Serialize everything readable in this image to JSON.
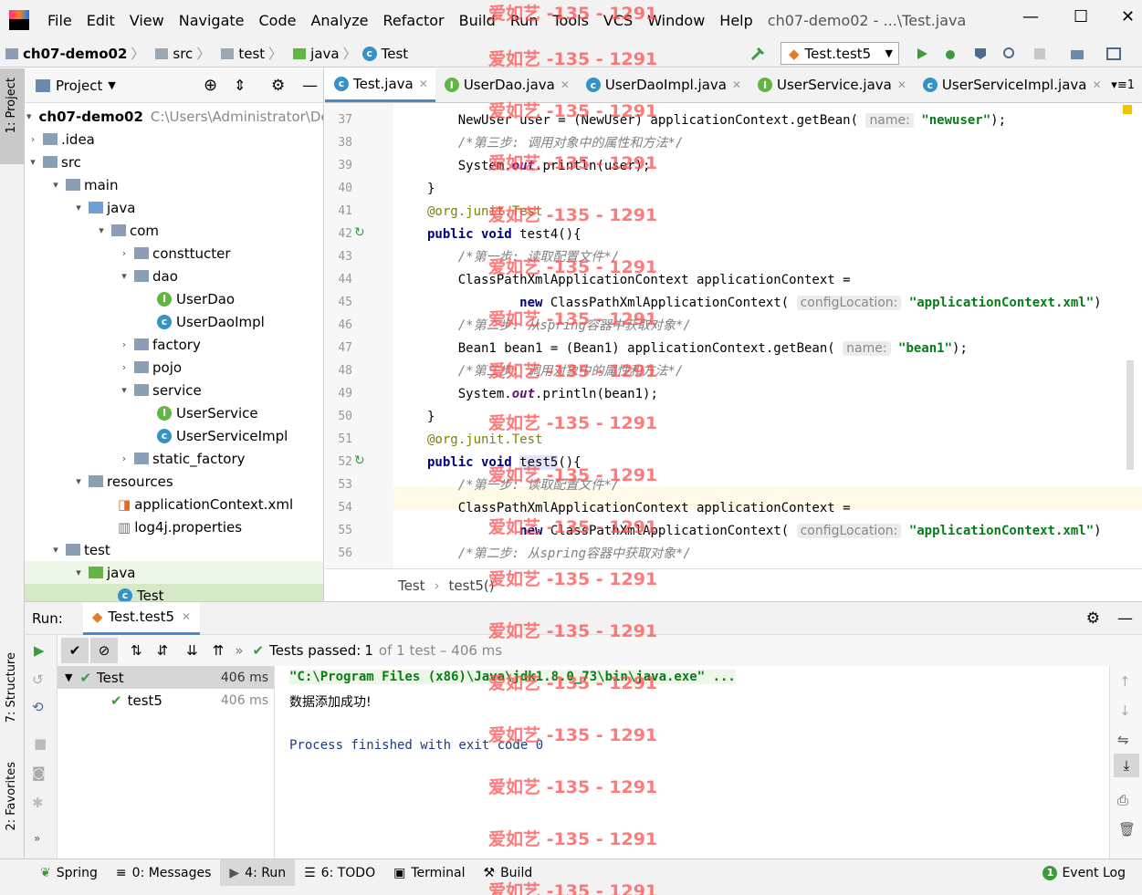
{
  "menubar": {
    "items": [
      "File",
      "Edit",
      "View",
      "Navigate",
      "Code",
      "Analyze",
      "Refactor",
      "Build",
      "Run",
      "Tools",
      "VCS",
      "Window",
      "Help"
    ],
    "title": "ch07-demo02 - ...\\Test.java"
  },
  "navbar": {
    "crumbs": [
      "ch07-demo02",
      "src",
      "test",
      "java",
      "Test"
    ],
    "run_config": "Test.test5"
  },
  "project": {
    "header": "Project",
    "tree": [
      {
        "label": "ch07-demo02",
        "dim": "C:\\Users\\Administrator\\De"
      },
      {
        "label": ".idea"
      },
      {
        "label": "src"
      },
      {
        "label": "main"
      },
      {
        "label": "java"
      },
      {
        "label": "com"
      },
      {
        "label": "consttucter"
      },
      {
        "label": "dao"
      },
      {
        "label": "UserDao"
      },
      {
        "label": "UserDaoImpl"
      },
      {
        "label": "factory"
      },
      {
        "label": "pojo"
      },
      {
        "label": "service"
      },
      {
        "label": "UserService"
      },
      {
        "label": "UserServiceImpl"
      },
      {
        "label": "static_factory"
      },
      {
        "label": "resources"
      },
      {
        "label": "applicationContext.xml"
      },
      {
        "label": "log4j.properties"
      },
      {
        "label": "test"
      },
      {
        "label": "java"
      },
      {
        "label": "Test"
      }
    ]
  },
  "editor": {
    "tabs": [
      "Test.java",
      "UserDao.java",
      "UserDaoImpl.java",
      "UserService.java",
      "UserServiceImpl.java"
    ],
    "tab_count": "1",
    "line_numbers": [
      "37",
      "38",
      "39",
      "40",
      "41",
      "42",
      "43",
      "44",
      "45",
      "46",
      "47",
      "48",
      "49",
      "50",
      "51",
      "52",
      "53",
      "54",
      "55",
      "56"
    ],
    "breadcrumb": [
      "Test",
      "test5()"
    ]
  },
  "run": {
    "label": "Run:",
    "tab": "Test.test5",
    "tests_passed_label": "Tests passed:",
    "tests_passed_count": "1",
    "tests_passed_rest": "of 1 test – 406 ms",
    "tree": [
      {
        "label": "Test",
        "time": "406 ms"
      },
      {
        "label": "test5",
        "time": "406 ms"
      }
    ],
    "console": [
      "\"C:\\Program Files (x86)\\Java\\jdk1.8.0_73\\bin\\java.exe\" ...",
      "数据添加成功!",
      "",
      "Process finished with exit code 0"
    ]
  },
  "bottom_tabs": [
    "Spring",
    "0: Messages",
    "4: Run",
    "6: TODO",
    "Terminal",
    "Build"
  ],
  "event_log": "Event Log",
  "left_tabs": [
    "1: Project",
    "7: Structure",
    "2: Favorites"
  ],
  "watermark": "爱如艺 -135 - 1291"
}
